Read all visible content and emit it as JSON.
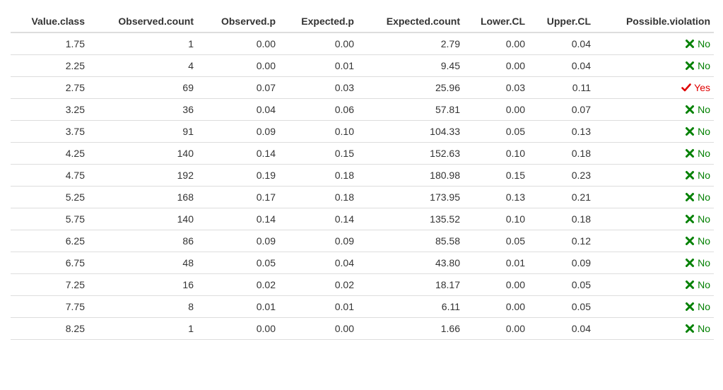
{
  "table": {
    "columns": [
      "Value.class",
      "Observed.count",
      "Observed.p",
      "Expected.p",
      "Expected.count",
      "Lower.CL",
      "Upper.CL",
      "Possible.violation"
    ],
    "rows": [
      [
        "1.75",
        "1",
        "0.00",
        "0.00",
        "2.79",
        "0.00",
        "0.04",
        "No"
      ],
      [
        "2.25",
        "4",
        "0.00",
        "0.01",
        "9.45",
        "0.00",
        "0.04",
        "No"
      ],
      [
        "2.75",
        "69",
        "0.07",
        "0.03",
        "25.96",
        "0.03",
        "0.11",
        "Yes"
      ],
      [
        "3.25",
        "36",
        "0.04",
        "0.06",
        "57.81",
        "0.00",
        "0.07",
        "No"
      ],
      [
        "3.75",
        "91",
        "0.09",
        "0.10",
        "104.33",
        "0.05",
        "0.13",
        "No"
      ],
      [
        "4.25",
        "140",
        "0.14",
        "0.15",
        "152.63",
        "0.10",
        "0.18",
        "No"
      ],
      [
        "4.75",
        "192",
        "0.19",
        "0.18",
        "180.98",
        "0.15",
        "0.23",
        "No"
      ],
      [
        "5.25",
        "168",
        "0.17",
        "0.18",
        "173.95",
        "0.13",
        "0.21",
        "No"
      ],
      [
        "5.75",
        "140",
        "0.14",
        "0.14",
        "135.52",
        "0.10",
        "0.18",
        "No"
      ],
      [
        "6.25",
        "86",
        "0.09",
        "0.09",
        "85.58",
        "0.05",
        "0.12",
        "No"
      ],
      [
        "6.75",
        "48",
        "0.05",
        "0.04",
        "43.80",
        "0.01",
        "0.09",
        "No"
      ],
      [
        "7.25",
        "16",
        "0.02",
        "0.02",
        "18.17",
        "0.00",
        "0.05",
        "No"
      ],
      [
        "7.75",
        "8",
        "0.01",
        "0.01",
        "6.11",
        "0.00",
        "0.05",
        "No"
      ],
      [
        "8.25",
        "1",
        "0.00",
        "0.00",
        "1.66",
        "0.00",
        "0.04",
        "No"
      ]
    ]
  },
  "icons": {
    "no": "cross-icon",
    "yes": "check-icon"
  },
  "colors": {
    "no": "#008000",
    "yes": "#e00000",
    "text": "#333333",
    "rule": "#dddddd"
  }
}
